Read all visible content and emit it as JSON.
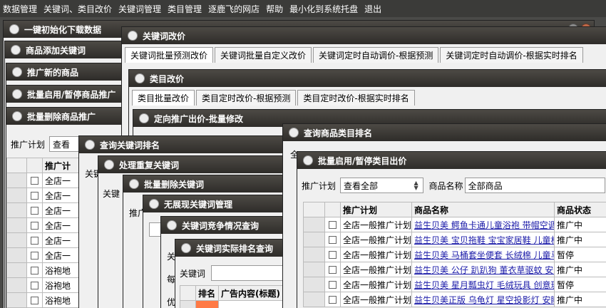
{
  "menubar": [
    "数据管理",
    "关键词、类目改价",
    "关键词管理",
    "类目管理",
    "逐鹿飞的网店",
    "帮助",
    "最小化到系统托盘",
    "退出"
  ],
  "left_windows": {
    "init": "一键初始化下载数据",
    "add_keyword": "商品添加关键词",
    "promote_new": "推广新的商品",
    "batch_toggle": "批量启用/暂停商品推广",
    "batch_delete": "批量删除商品推广"
  },
  "delete_panel": {
    "label": "推广计划",
    "select": "查看",
    "header": "推广计",
    "rows": [
      "全店一",
      "全店一",
      "全店一",
      "全店一",
      "全店一",
      "全店一",
      "浴袍地",
      "浴袍地",
      "浴袍地"
    ]
  },
  "keyword_reprice": {
    "title": "关键词改价",
    "tabs": [
      "关键词批量预测改价",
      "关键词批量自定义改价",
      "关键词定时自动调价-根据预测",
      "关键词定时自动调价-根据实时排名"
    ]
  },
  "category_reprice": {
    "title": "类目改价",
    "tabs": [
      "类目批量改价",
      "类目定时改价-根据预测",
      "类目定时改价-根据实时排名"
    ]
  },
  "directed": {
    "title": "定向推广出价-批量修改"
  },
  "stack": {
    "query_rank": "查询关键词排名",
    "handle_dup": "处理重复关键词",
    "batch_del_kw": "批量删除关键词",
    "no_show": "无展现关键词管理",
    "competition": "关键词竞争情况查询",
    "actual_rank": "关键词实际排名查询"
  },
  "stack_labels": {
    "a": "关键",
    "b": "关键",
    "c": "推广",
    "d": "关",
    "e": "每",
    "f": "优"
  },
  "actual_rank_panel": {
    "keyword_label": "关键词",
    "headers": [
      "排名",
      "广告内容(标题)"
    ]
  },
  "category_rank": {
    "title": "查询商品类目排名",
    "frag": "全"
  },
  "batch_category": {
    "title": "批量启用/暂停类目出价",
    "plan_label": "推广计划",
    "plan_value": "查看全部",
    "name_label": "商品名称",
    "name_value": "全部商品",
    "headers": [
      "推广计划",
      "商品名称",
      "商品状态"
    ],
    "rows": [
      {
        "plan": "全店一般推广计划",
        "name": "益生贝美 鳄鱼卡通儿童浴袍 带帽空调",
        "status": "推广中"
      },
      {
        "plan": "全店一般推广计划",
        "name": "益生贝美 宝贝拖鞋 宝宝家居鞋 儿童棉",
        "status": "推广中"
      },
      {
        "plan": "全店一般推广计划",
        "name": "益生贝美 马桶套坐便套 长绒棉 儿童马",
        "status": "暂停"
      },
      {
        "plan": "全店一般推广计划",
        "name": "益生贝美 公仔 趴趴狗 董衣草驱蚊 安睡",
        "status": "推广中"
      },
      {
        "plan": "全店一般推广计划",
        "name": "益生贝美 星月瓢虫灯 毛绒玩具 创意玩",
        "status": "暂停"
      },
      {
        "plan": "全店一般推广计划",
        "name": "益生贝美正版 乌龟灯 星空投影灯 安睡",
        "status": "推广中"
      }
    ]
  }
}
